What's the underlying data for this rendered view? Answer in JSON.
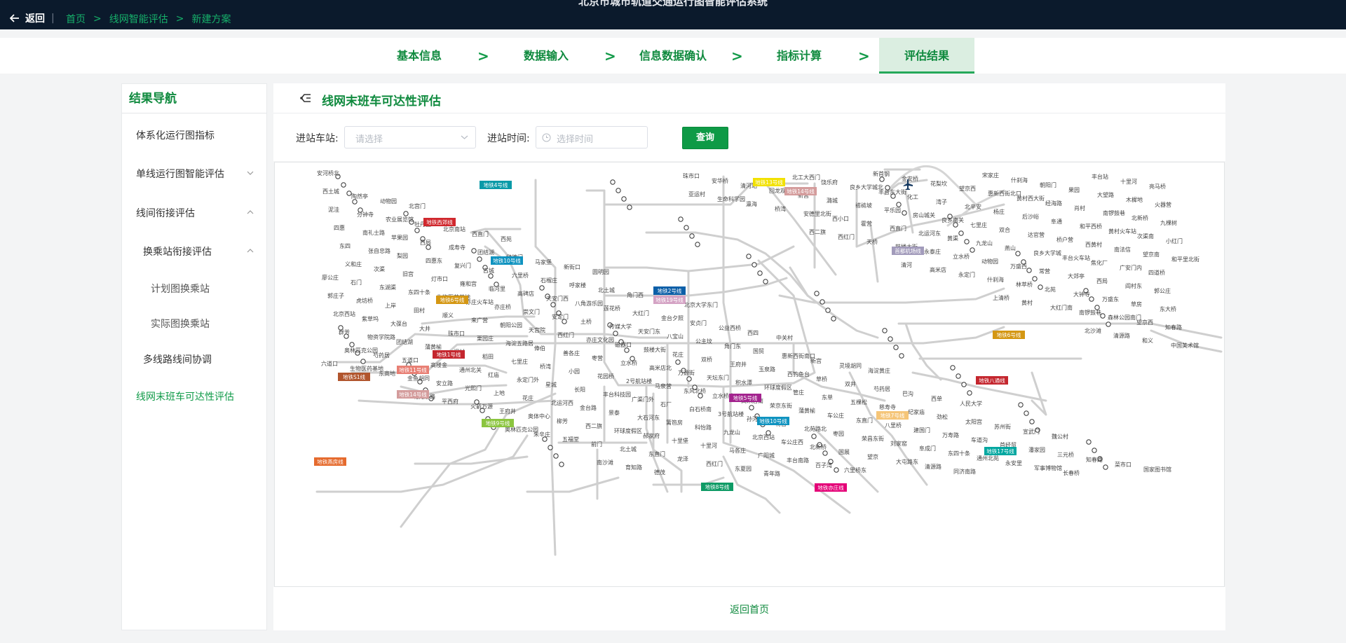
{
  "header": {
    "clipped_title": "北京市城市轨道交通运行图智能评估系统",
    "back_label": "返回",
    "breadcrumbs": [
      "首页",
      "线网智能评估",
      "新建方案"
    ],
    "separator": ">"
  },
  "steps": {
    "items": [
      "基本信息",
      "数据输入",
      "信息数据确认",
      "指标计算",
      "评估结果"
    ],
    "active_index": 4,
    "arrow": ">"
  },
  "sidebar": {
    "title": "结果导航",
    "items": [
      {
        "label": "体系化运行图指标"
      },
      {
        "label": "单线运行图智能评估",
        "chevron": "down"
      },
      {
        "label": "线间衔接评估",
        "chevron": "up"
      },
      {
        "label": "换乘站衔接评估",
        "chevron": "up"
      },
      {
        "label": "计划图换乘站"
      },
      {
        "label": "实际图换乘站"
      },
      {
        "label": "多线路线间协调"
      },
      {
        "label": "线网末班车可达性评估",
        "active": true
      }
    ]
  },
  "main": {
    "title": "线网末班车可达性评估",
    "title_icon": "network-icon",
    "filters": {
      "station_label": "进站车站:",
      "station_placeholder": "请选择",
      "time_label": "进站时间:",
      "time_placeholder": "选择时间",
      "query_button": "查询"
    },
    "back_home": "返回首页"
  },
  "map": {
    "line_tags": [
      {
        "label": "地铁4号线",
        "color": "#0a9aa8"
      },
      {
        "label": "地铁西郊线",
        "color": "#d0282e"
      },
      {
        "label": "地铁10号线",
        "color": "#0f93c0"
      },
      {
        "label": "地铁6号线",
        "color": "#d49713"
      },
      {
        "label": "地铁1号线",
        "color": "#c4262e"
      },
      {
        "label": "地铁11号线",
        "color": "#e87f74"
      },
      {
        "label": "地铁S1线",
        "color": "#b1552d"
      },
      {
        "label": "地铁14号线",
        "color": "#d49c9c"
      },
      {
        "label": "地铁9号线",
        "color": "#8bc53f"
      },
      {
        "label": "地铁燕房线",
        "color": "#e56a2d"
      },
      {
        "label": "地铁2号线",
        "color": "#0c5fa8"
      },
      {
        "label": "地铁19号线",
        "color": "#d4a3c4"
      },
      {
        "label": "地铁5号线",
        "color": "#a3238e"
      },
      {
        "label": "地铁10号线",
        "color": "#0f93c0"
      },
      {
        "label": "地铁8号线",
        "color": "#0f9b66"
      },
      {
        "label": "地铁亦庄线",
        "color": "#e40077"
      },
      {
        "label": "地铁17号线",
        "color": "#00a7a0"
      },
      {
        "label": "地铁7号线",
        "color": "#f5c578"
      },
      {
        "label": "地铁八通线",
        "color": "#c4262e"
      },
      {
        "label": "地铁6号线",
        "color": "#d49713"
      },
      {
        "label": "首都机场线",
        "color": "#a29bbb"
      },
      {
        "label": "地铁14号线",
        "color": "#d49c9c"
      },
      {
        "label": "地铁13号线",
        "color": "#f2e100"
      }
    ],
    "station_labels": [
      "安河桥北",
      "北宫门",
      "西苑",
      "圆明园",
      "北京大学东门",
      "中关村",
      "海淀黄庄",
      "人民大学",
      "魏公村",
      "国家图书馆",
      "动物园",
      "西直门",
      "新街口",
      "平安里",
      "西四",
      "灵境胡同",
      "西单",
      "宣武门",
      "菜市口",
      "陶然亭",
      "北京南站",
      "马家堡",
      "角门西",
      "公益西桥",
      "新宫",
      "巴沟",
      "苏州街",
      "知春路",
      "西土城",
      "牡丹园",
      "健德门",
      "北土城",
      "安贞门",
      "惠新西街南口",
      "芍药居",
      "太阳宫",
      "三元桥",
      "亮马桥",
      "农业展览馆",
      "团结湖",
      "呼家楼",
      "金台夕照",
      "国贸",
      "双井",
      "劲松",
      "潘家园",
      "十里河",
      "分钟寺",
      "成寿寺",
      "石榴庄",
      "大红门",
      "角门东",
      "草桥",
      "纪家庙",
      "首经贸",
      "丰台站",
      "泥洼",
      "西局",
      "六里桥",
      "莲花桥",
      "公主坟",
      "西钓鱼台",
      "慈寿寺",
      "车道沟",
      "长春桥",
      "火器营",
      "苹果园",
      "古城",
      "八角游乐园",
      "八宝山",
      "玉泉路",
      "五棵松",
      "万寿路",
      "军事博物馆",
      "木樨地",
      "南礼士路",
      "复兴门",
      "天安门西",
      "天安门东",
      "王府井",
      "东单",
      "建国门",
      "永安里",
      "大望路",
      "四惠",
      "四惠东",
      "高碑店",
      "传媒大学",
      "双桥",
      "管庄",
      "八里桥",
      "通州北苑",
      "果园",
      "九棵树",
      "梨园",
      "临河里",
      "土桥",
      "花庄",
      "环球度假区",
      "东直门",
      "东四十条",
      "朝阳门",
      "北新桥",
      "张自忠路",
      "雍和宫",
      "安定门",
      "鼓楼大街",
      "积水潭",
      "车公庄",
      "阜成门",
      "什刹海",
      "南锣鼓巷",
      "东四",
      "灯市口",
      "崇文门",
      "磁器口",
      "天坛东门",
      "蒲黄榆",
      "刘家窑",
      "宋家庄",
      "肖村",
      "小红门",
      "旧宫",
      "亦庄桥",
      "亦庄文化园",
      "万源街",
      "荣京东街",
      "荣昌东街",
      "同济南路",
      "经海路",
      "次渠南",
      "次渠",
      "亦庄火车站",
      "西红门",
      "高米店北",
      "高米店南",
      "枣园",
      "清源路",
      "黄村西大街",
      "黄村火车站",
      "义和庄",
      "生物医药基地",
      "天宫院",
      "立水桥",
      "立水桥南",
      "北苑路北",
      "大屯路东",
      "惠新西街北口",
      "和平西桥",
      "和平里北街",
      "东四十条",
      "朝阳公园",
      "枣营",
      "东风北桥",
      "将台",
      "望京",
      "望京西",
      "阜通",
      "望京南",
      "东湖渠",
      "来广营",
      "善各庄",
      "马泉营",
      "孙河",
      "国展",
      "花梨坎",
      "后沙峪",
      "南法信",
      "石门",
      "顺义",
      "俸伯",
      "2号航站楼",
      "3号航站楼",
      "北新桥",
      "金安桥",
      "杨庄",
      "西黄村",
      "廖公庄",
      "田村",
      "海淀五路居",
      "花园桥",
      "白石桥南",
      "车公庄西",
      "新首钢",
      "北辛安",
      "桥户营",
      "四道桥",
      "上岸",
      "栗园庄",
      "小园",
      "石厂",
      "北京西站",
      "六里桥东",
      "湾子",
      "达官营",
      "广安门内",
      "虎坊桥",
      "珠市口",
      "桥湾",
      "广渠门外",
      "九龙山",
      "百子湾",
      "化工",
      "双合",
      "焦化厂",
      "郭庄子",
      "大井",
      "七里庄",
      "丰台科技园",
      "科怡路",
      "丰台南路",
      "丰台东大街",
      "七里庄",
      "丰台火车站",
      "郭公庄",
      "大葆台",
      "稻田",
      "长阳",
      "篱笆房",
      "广阳城",
      "良乡大学城北",
      "良乡南关",
      "良乡大学城",
      "阎村东",
      "紫草坞",
      "阎村",
      "星城",
      "大石河东",
      "马各庄",
      "饶乐府",
      "房山城关",
      "燕山",
      "西局",
      "北京西站",
      "蒲黄榆",
      "永定门外",
      "景泰",
      "十里河",
      "北工大西门",
      "平乐园",
      "九龙山",
      "大郊亭",
      "东大桥",
      "团结湖",
      "红庙",
      "金台路",
      "十里堡",
      "青年路",
      "褡裢坡",
      "黄渠",
      "常营",
      "草房",
      "物资学院路",
      "通州北关",
      "北运河西",
      "郝家府",
      "东夏园",
      "潞城",
      "北运河东",
      "万盛西",
      "万盛东",
      "群芳",
      "高楼金",
      "花庄",
      "环球度假区",
      "西红门",
      "新宫",
      "西直门",
      "动物园",
      "大钟寺",
      "知春路",
      "五道口",
      "上地",
      "西二旗",
      "龙泽",
      "回龙观",
      "霍营",
      "立水桥",
      "北苑",
      "望京西",
      "芍药居",
      "光熙门",
      "柳芳",
      "东直门",
      "清河站",
      "西小口",
      "永泰庄",
      "林萃桥",
      "森林公园南门",
      "奥林匹克公园",
      "安立路",
      "奥体中心",
      "北土城",
      "安华桥",
      "安德里北街",
      "鼓楼大街",
      "什刹海",
      "南锣鼓巷",
      "中国美术馆",
      "金鱼胡同",
      "王府井",
      "前门",
      "珠市口",
      "桥湾",
      "天桥",
      "永定门",
      "大红门南",
      "和义",
      "东高地",
      "火箭万源",
      "五福堂",
      "德茂",
      "瀛海",
      "西红门",
      "高米店",
      "黄村",
      "清源路",
      "生物医药基地",
      "平西府",
      "朱辛庄",
      "育知路",
      "生命科学园",
      "西二旗",
      "清河",
      "上清桥",
      "北沙滩",
      "六道口",
      "北苑东路",
      "奥林匹克公园",
      "南沙滩",
      "亚运村"
    ]
  }
}
